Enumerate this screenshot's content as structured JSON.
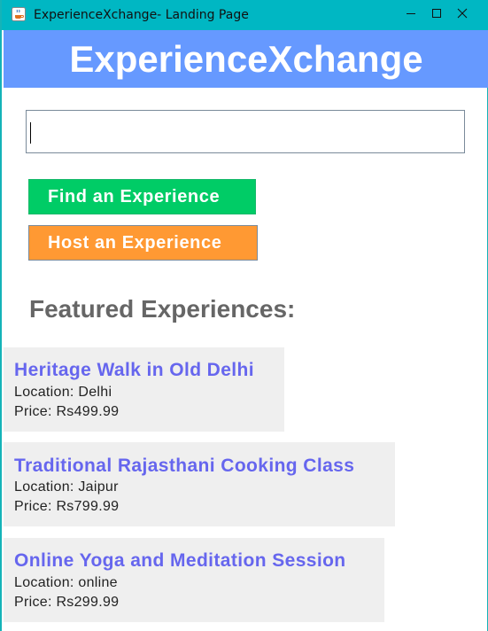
{
  "window": {
    "title": "ExperienceXchange- Landing Page",
    "app_icon": "java-coffee-icon",
    "controls": [
      "minimize-icon",
      "maximize-icon",
      "close-icon"
    ]
  },
  "header": {
    "title": "ExperienceXchange",
    "background": "#6699ff"
  },
  "search": {
    "value": "",
    "placeholder": ""
  },
  "buttons": {
    "find_label": "Find an Experience",
    "host_label": "Host an Experience",
    "find_color": "#00cc66",
    "host_color": "#ff9933"
  },
  "featured": {
    "heading": "Featured Experiences:",
    "items": [
      {
        "title": "Heritage Walk in Old Delhi",
        "location": "Location: Delhi",
        "price": "Price: Rs499.99"
      },
      {
        "title": "Traditional Rajasthani Cooking Class",
        "location": "Location: Jaipur",
        "price": "Price: Rs799.99"
      },
      {
        "title": "Online Yoga and Meditation Session",
        "location": "Location: online",
        "price": "Price: Rs299.99"
      }
    ]
  }
}
